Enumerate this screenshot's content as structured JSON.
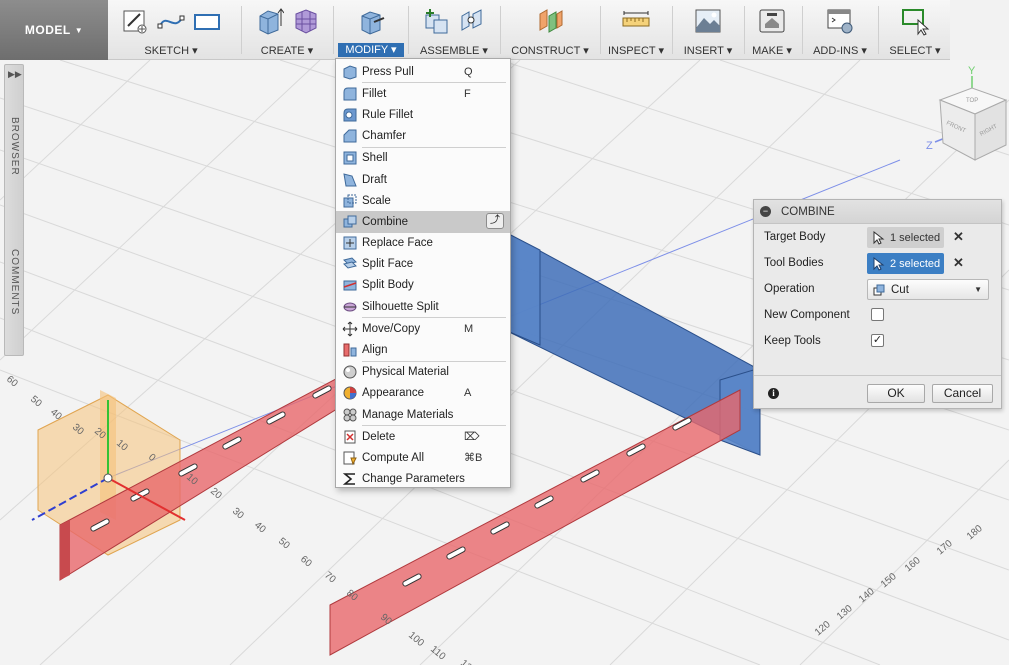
{
  "toolbar": {
    "model": "MODEL",
    "groups": [
      {
        "label": "SKETCH ▾"
      },
      {
        "label": "CREATE ▾"
      },
      {
        "label": "MODIFY ▾"
      },
      {
        "label": "ASSEMBLE ▾"
      },
      {
        "label": "CONSTRUCT ▾"
      },
      {
        "label": "INSPECT ▾"
      },
      {
        "label": "INSERT ▾"
      },
      {
        "label": "MAKE ▾"
      },
      {
        "label": "ADD-INS ▾"
      },
      {
        "label": "SELECT ▾"
      }
    ],
    "active_group": "MODIFY ▾"
  },
  "sidepanel": {
    "browser": "BROWSER",
    "comments": "COMMENTS"
  },
  "modify_menu": {
    "items": [
      {
        "label": "Press Pull",
        "key": "Q",
        "icon": "press-pull-icon"
      },
      {
        "label": "Fillet",
        "key": "F",
        "icon": "fillet-icon"
      },
      {
        "label": "Rule Fillet",
        "key": "",
        "icon": "rule-fillet-icon"
      },
      {
        "label": "Chamfer",
        "key": "",
        "icon": "chamfer-icon"
      },
      {
        "label": "Shell",
        "key": "",
        "icon": "shell-icon"
      },
      {
        "label": "Draft",
        "key": "",
        "icon": "draft-icon"
      },
      {
        "label": "Scale",
        "key": "",
        "icon": "scale-icon"
      },
      {
        "label": "Combine",
        "key": "",
        "icon": "combine-icon"
      },
      {
        "label": "Replace Face",
        "key": "",
        "icon": "replace-face-icon"
      },
      {
        "label": "Split Face",
        "key": "",
        "icon": "split-face-icon"
      },
      {
        "label": "Split Body",
        "key": "",
        "icon": "split-body-icon"
      },
      {
        "label": "Silhouette Split",
        "key": "",
        "icon": "silhouette-split-icon"
      },
      {
        "label": "Move/Copy",
        "key": "M",
        "icon": "move-copy-icon"
      },
      {
        "label": "Align",
        "key": "",
        "icon": "align-icon"
      },
      {
        "label": "Physical Material",
        "key": "",
        "icon": "physical-material-icon"
      },
      {
        "label": "Appearance",
        "key": "A",
        "icon": "appearance-icon"
      },
      {
        "label": "Manage Materials",
        "key": "",
        "icon": "manage-materials-icon"
      },
      {
        "label": "Delete",
        "key": "⌦",
        "icon": "delete-icon"
      },
      {
        "label": "Compute All",
        "key": "⌘B",
        "icon": "compute-all-icon"
      },
      {
        "label": "Change Parameters",
        "key": "",
        "icon": "change-parameters-icon"
      }
    ],
    "highlighted": "Combine"
  },
  "combine_dialog": {
    "title": "COMBINE",
    "target_body_label": "Target Body",
    "target_body_value": "1 selected",
    "tool_bodies_label": "Tool Bodies",
    "tool_bodies_value": "2 selected",
    "operation_label": "Operation",
    "operation_value": "Cut",
    "new_component_label": "New Component",
    "new_component_checked": false,
    "keep_tools_label": "Keep Tools",
    "keep_tools_checked": true,
    "ok": "OK",
    "cancel": "Cancel"
  },
  "viewcube": {
    "top": "TOP",
    "front": "FRONT",
    "right": "RIGHT",
    "y_axis": "Y",
    "z_axis": "Z"
  },
  "grid_labels": [
    "60",
    "50",
    "40",
    "30",
    "20",
    "10",
    "0",
    "10",
    "20",
    "30",
    "40",
    "50",
    "60",
    "70",
    "80",
    "90",
    "100",
    "110",
    "120",
    "130",
    "140",
    "150",
    "160",
    "170",
    "180"
  ],
  "colors": {
    "accent": "#2f6fb3",
    "red_body": "#e8686c",
    "blue_body": "#3f6fb8",
    "plane": "#f5c27a"
  }
}
